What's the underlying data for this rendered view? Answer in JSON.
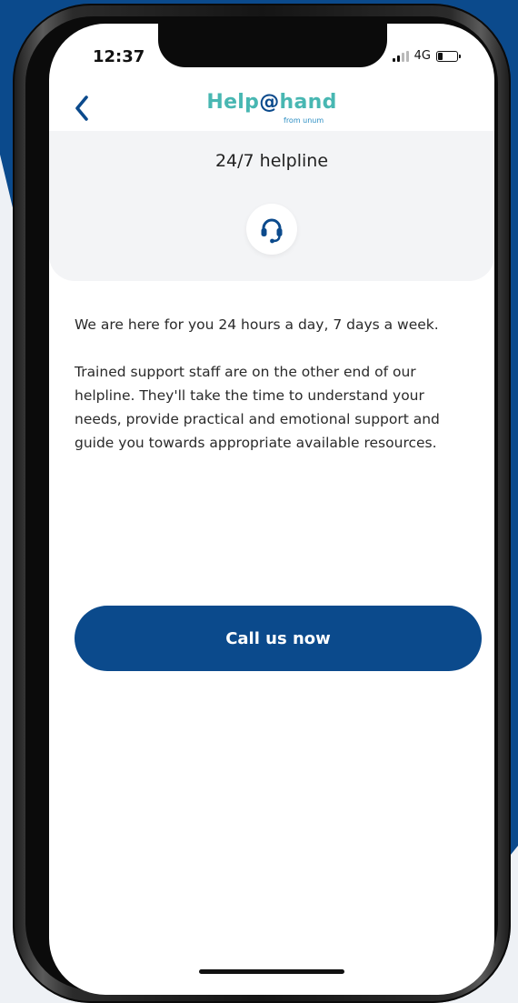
{
  "status_bar": {
    "time": "12:37",
    "network": "4G"
  },
  "nav": {
    "back_icon": "chevron-left-icon",
    "logo_main_a": "Help",
    "logo_at": "@",
    "logo_main_b": "hand",
    "logo_sub": "from unum"
  },
  "hero": {
    "title": "24/7 helpline",
    "icon": "headset-icon"
  },
  "content": {
    "paragraph_1": "We are here for you 24 hours a day, 7 days a week.",
    "paragraph_2": "Trained support staff are on the other end of our helpline. They'll take the time to understand your needs, provide practical and emotional support and guide you towards appropriate available resources."
  },
  "cta": {
    "label": "Call us now"
  },
  "colors": {
    "brand_blue": "#0b4a8c",
    "brand_teal": "#48b7b2"
  }
}
